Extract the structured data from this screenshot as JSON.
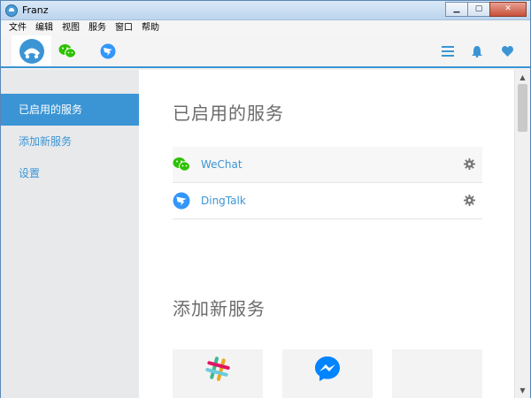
{
  "window": {
    "title": "Franz",
    "controls": {
      "minimize": "▁",
      "maximize": "▢",
      "close": "✕"
    }
  },
  "menu": [
    "文件",
    "编辑",
    "视图",
    "服务",
    "窗口",
    "帮助"
  ],
  "header": {
    "tabs": [
      {
        "icon": "franz-logo-icon",
        "active": true
      },
      {
        "icon": "wechat-icon",
        "active": false
      },
      {
        "icon": "dingtalk-icon",
        "active": false
      }
    ],
    "right_icons": [
      "menu-icon",
      "bell-icon",
      "heart-icon"
    ],
    "accent": "#3b95d5"
  },
  "sidebar": {
    "items": [
      {
        "label": "已启用的服务",
        "active": true
      },
      {
        "label": "添加新服务",
        "active": false
      },
      {
        "label": "设置",
        "active": false
      }
    ]
  },
  "main": {
    "enabled_title": "已启用的服务",
    "services": [
      {
        "name": "WeChat",
        "icon": "wechat-icon",
        "color": "#2dc100"
      },
      {
        "name": "DingTalk",
        "icon": "dingtalk-icon",
        "color": "#3296fa"
      }
    ],
    "add_title": "添加新服务",
    "tiles": [
      {
        "icon": "slack-icon"
      },
      {
        "icon": "messenger-icon"
      },
      {
        "icon": "blank-icon"
      }
    ]
  },
  "scrollbar": {
    "up": "▲",
    "down": "▼"
  }
}
